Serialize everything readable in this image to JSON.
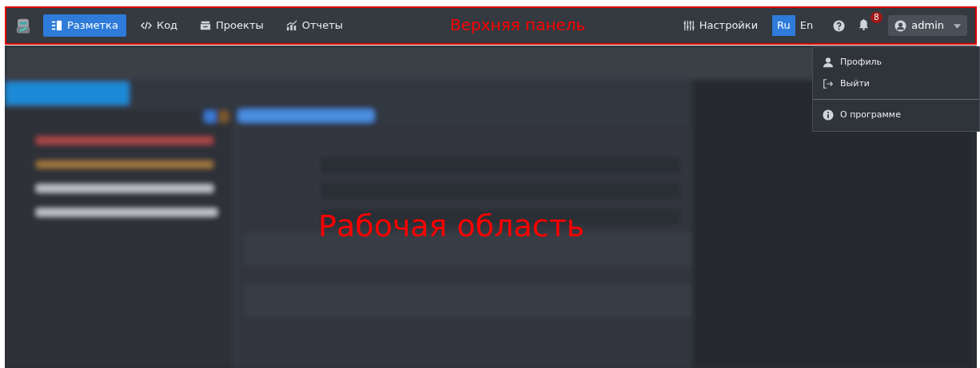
{
  "annotations": [
    {
      "text": "Верхняя панель"
    },
    {
      "text": "Рабочая область"
    }
  ],
  "navbar": {
    "nav_items": [
      {
        "label": "Разметка",
        "selected": true
      },
      {
        "label": "Код",
        "selected": false
      },
      {
        "label": "Проекты",
        "selected": false
      },
      {
        "label": "Отчеты",
        "selected": false
      }
    ],
    "settings": "Настройки",
    "languages": [
      {
        "label": "Ru",
        "selected": true
      },
      {
        "label": "En",
        "selected": false
      }
    ],
    "notifications": {
      "count": "8"
    },
    "user": {
      "name": "admin",
      "expanded": true
    }
  },
  "user_menu": {
    "items": [
      {
        "kind": "item",
        "label": "Профиль"
      },
      {
        "kind": "item",
        "label": "Выйти"
      },
      {
        "kind": "divider"
      },
      {
        "kind": "item",
        "label": "О программе"
      }
    ]
  }
}
